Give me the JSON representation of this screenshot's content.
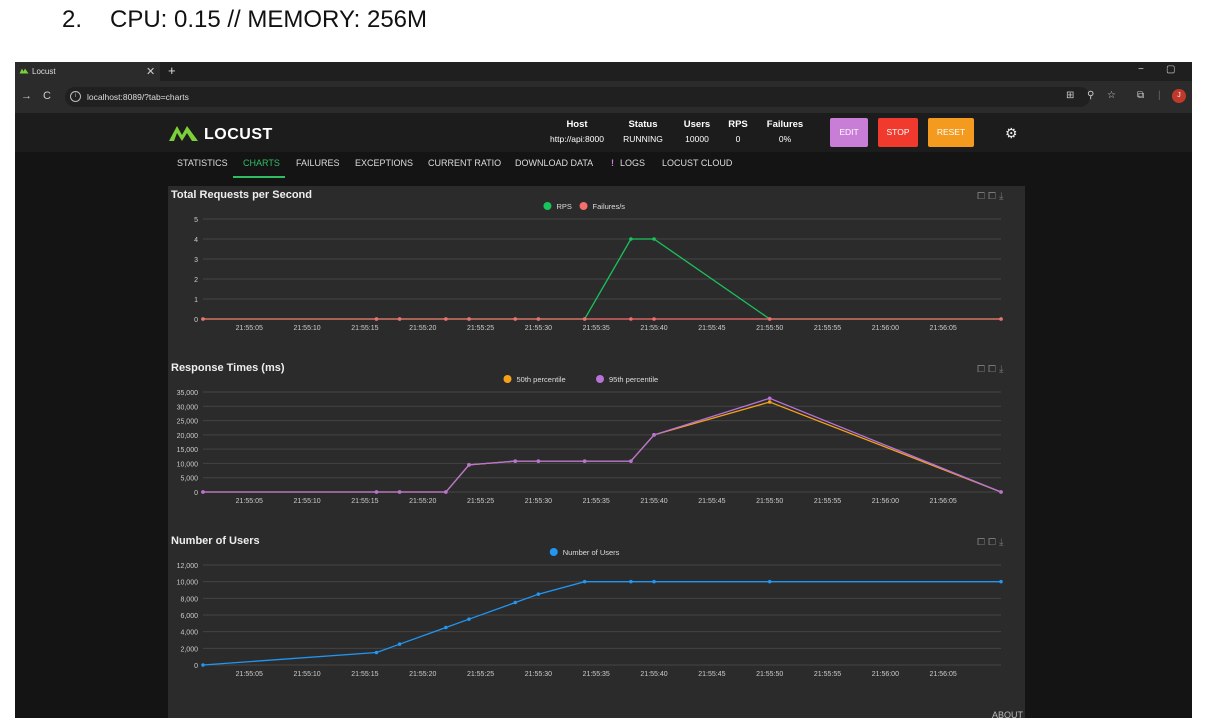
{
  "caption": {
    "number": "2.",
    "text": "CPU: 0.15 // MEMORY: 256M"
  },
  "browser": {
    "tab_title": "Locust",
    "tab_close": "✕",
    "new_tab": "+",
    "window_controls": [
      "−",
      "▢"
    ],
    "back": "→",
    "reload": "C",
    "url": "localhost:8089/?tab=charts",
    "tools": [
      "⊞",
      "⚲",
      "☆",
      "⧉",
      "|"
    ],
    "avatar": "J"
  },
  "header": {
    "brand": "LOCUST",
    "stats": [
      {
        "label": "Host",
        "value": "http://api:8000"
      },
      {
        "label": "Status",
        "value": "RUNNING"
      },
      {
        "label": "Users",
        "value": "10000"
      },
      {
        "label": "RPS",
        "value": "0"
      },
      {
        "label": "Failures",
        "value": "0%"
      }
    ],
    "buttons": {
      "edit": "EDIT",
      "stop": "STOP",
      "reset": "RESET"
    },
    "colors": {
      "edit": "#c87dd6",
      "stop": "#f03a2e",
      "reset": "#f39a1f",
      "accent": "#2fbf62"
    }
  },
  "nav": {
    "tabs": [
      "STATISTICS",
      "CHARTS",
      "FAILURES",
      "EXCEPTIONS",
      "CURRENT RATIO",
      "DOWNLOAD DATA",
      "LOGS",
      "LOCUST CLOUD"
    ],
    "active": "CHARTS"
  },
  "chart_tools": "⧠⧠⤓",
  "footer": {
    "about": "ABOUT"
  },
  "chart_data": [
    {
      "type": "line",
      "title": "Total Requests per Second",
      "x": [
        "21:55:01",
        "21:55:16",
        "21:55:18",
        "21:55:22",
        "21:55:24",
        "21:55:28",
        "21:55:30",
        "21:55:34",
        "21:55:38",
        "21:55:40",
        "21:55:50",
        "21:56:10"
      ],
      "x_ticks": [
        "21:55:05",
        "21:55:10",
        "21:55:15",
        "21:55:20",
        "21:55:25",
        "21:55:30",
        "21:55:35",
        "21:55:40",
        "21:55:45",
        "21:55:50",
        "21:55:55",
        "21:56:00",
        "21:56:05"
      ],
      "y_ticks": [
        "0",
        "1",
        "2",
        "3",
        "4",
        "5"
      ],
      "ylim": [
        0,
        5
      ],
      "series": [
        {
          "name": "RPS",
          "color": "#19c35c",
          "values": [
            0,
            0,
            0,
            0,
            0,
            0,
            0,
            0,
            4,
            4,
            0,
            0
          ]
        },
        {
          "name": "Failures/s",
          "color": "#f56d6d",
          "values": [
            0,
            0,
            0,
            0,
            0,
            0,
            0,
            0,
            0,
            0,
            0,
            0
          ]
        }
      ]
    },
    {
      "type": "line",
      "title": "Response Times (ms)",
      "x": [
        "21:55:01",
        "21:55:16",
        "21:55:18",
        "21:55:22",
        "21:55:24",
        "21:55:28",
        "21:55:30",
        "21:55:34",
        "21:55:38",
        "21:55:40",
        "21:55:50",
        "21:56:10"
      ],
      "x_ticks": [
        "21:55:05",
        "21:55:10",
        "21:55:15",
        "21:55:20",
        "21:55:25",
        "21:55:30",
        "21:55:35",
        "21:55:40",
        "21:55:45",
        "21:55:50",
        "21:55:55",
        "21:56:00",
        "21:56:05"
      ],
      "y_ticks": [
        "0",
        "5,000",
        "10,000",
        "15,000",
        "20,000",
        "25,000",
        "30,000",
        "35,000"
      ],
      "ylim": [
        0,
        35000
      ],
      "series": [
        {
          "name": "50th percentile",
          "color": "#f5a21a",
          "values": [
            0,
            0,
            0,
            0,
            9500,
            10800,
            10800,
            10800,
            10800,
            20000,
            31500,
            0
          ]
        },
        {
          "name": "95th percentile",
          "color": "#b673d9",
          "values": [
            0,
            0,
            0,
            0,
            9500,
            10800,
            10800,
            10800,
            10800,
            20000,
            32800,
            0
          ]
        }
      ]
    },
    {
      "type": "line",
      "title": "Number of Users",
      "x": [
        "21:55:01",
        "21:55:16",
        "21:55:18",
        "21:55:22",
        "21:55:24",
        "21:55:28",
        "21:55:30",
        "21:55:34",
        "21:55:38",
        "21:55:40",
        "21:55:50",
        "21:56:10"
      ],
      "x_ticks": [
        "21:55:05",
        "21:55:10",
        "21:55:15",
        "21:55:20",
        "21:55:25",
        "21:55:30",
        "21:55:35",
        "21:55:40",
        "21:55:45",
        "21:55:50",
        "21:55:55",
        "21:56:00",
        "21:56:05"
      ],
      "y_ticks": [
        "0",
        "2,000",
        "4,000",
        "6,000",
        "8,000",
        "10,000",
        "12,000"
      ],
      "ylim": [
        0,
        12000
      ],
      "series": [
        {
          "name": "Number of Users",
          "color": "#2196f3",
          "values": [
            0,
            1500,
            2500,
            4500,
            5500,
            7500,
            8500,
            10000,
            10000,
            10000,
            10000,
            10000
          ]
        }
      ]
    }
  ]
}
